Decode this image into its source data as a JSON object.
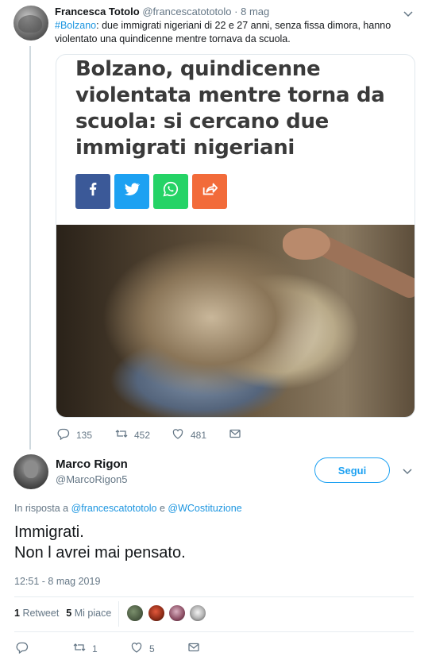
{
  "tweet1": {
    "name": "Francesca Totolo",
    "handle": "@francescatototolo",
    "separator": "·",
    "date": "8 mag",
    "hashtag": "#Bolzano",
    "text": ": due immigrati nigeriani di 22 e 27 anni, senza fissa dimora, hanno violentato una quindicenne mentre tornava da scuola.",
    "card": {
      "title": "Bolzano, quindicenne violentata mentre torna da scuola: si cercano due immigrati nigeriani",
      "share_buttons": [
        "facebook-icon",
        "twitter-icon",
        "whatsapp-icon",
        "share-icon"
      ]
    },
    "actions": {
      "replies": "135",
      "retweets": "452",
      "likes": "481"
    }
  },
  "tweet2": {
    "name": "Marco Rigon",
    "handle": "@MarcoRigon5",
    "follow_label": "Segui",
    "reply_prefix": "In risposta a ",
    "reply_user1": "@francescatototolo",
    "reply_conj": " e ",
    "reply_user2": "@WCostituzione",
    "text_line1": "Immigrati.",
    "text_line2": "Non l avrei mai pensato.",
    "timestamp": "12:51 - 8 mag 2019",
    "stats": {
      "retweets_count": "1",
      "retweets_label": "Retweet",
      "likes_count": "5",
      "likes_label": "Mi piace"
    },
    "actions": {
      "replies": "",
      "retweets": "1",
      "likes": "5"
    }
  },
  "colors": {
    "link": "#1b95e0",
    "accent": "#1da1f2",
    "muted": "#657786",
    "facebook": "#3b5998",
    "twitter": "#1da1f2",
    "whatsapp": "#25d366",
    "share": "#f26b3a"
  }
}
